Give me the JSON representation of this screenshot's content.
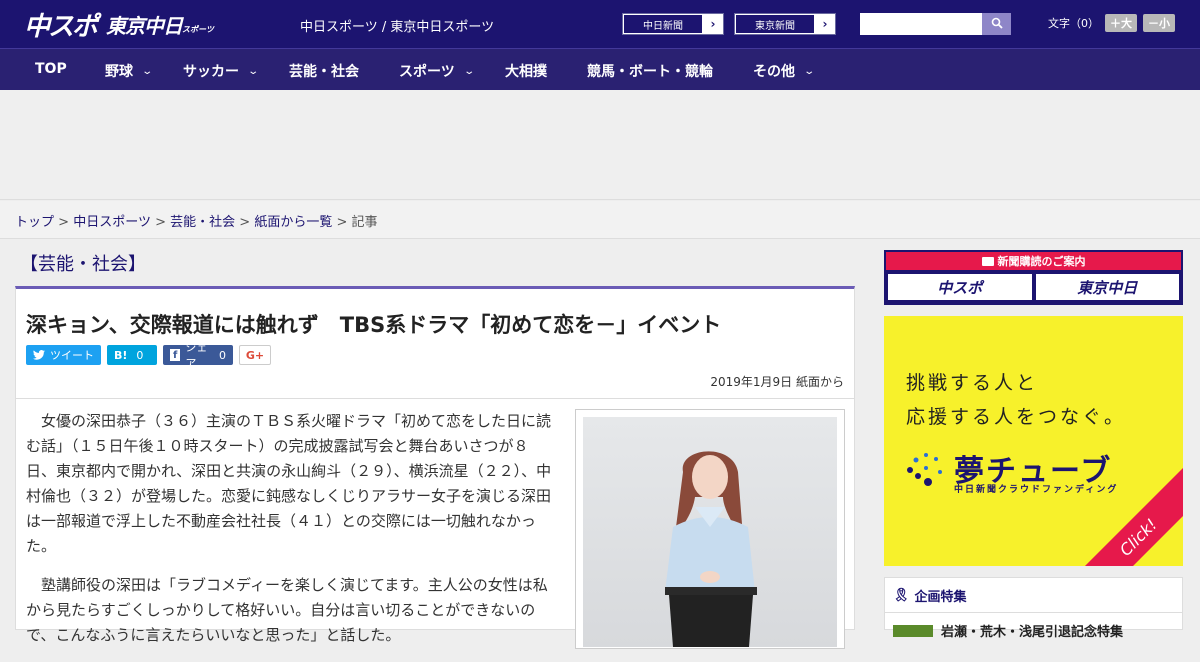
{
  "header": {
    "logo_main": "中スポ",
    "logo_sub": "東京中日",
    "logo_sub_tag": "スポーツ",
    "site_name": "中日スポーツ / 東京中日スポーツ",
    "btn_chunichi": "中日新聞",
    "btn_tokyo": "東京新聞",
    "search_placeholder": "",
    "font_label": "文字（0）",
    "font_plus": "＋大",
    "font_minus": "－小"
  },
  "nav": {
    "items": [
      {
        "label": "TOP",
        "dropdown": false
      },
      {
        "label": "野球",
        "dropdown": true
      },
      {
        "label": "サッカー",
        "dropdown": true
      },
      {
        "label": "芸能・社会",
        "dropdown": false
      },
      {
        "label": "スポーツ",
        "dropdown": true
      },
      {
        "label": "大相撲",
        "dropdown": false
      },
      {
        "label": "競馬・ボート・競輪",
        "dropdown": false
      },
      {
        "label": "その他",
        "dropdown": true
      }
    ]
  },
  "breadcrumb": {
    "items": [
      "トップ",
      "中日スポーツ",
      "芸能・社会",
      "紙面から一覧"
    ],
    "current": "記事",
    "separator": ">"
  },
  "article": {
    "category": "【芸能・社会】",
    "headline": "深キョン、交際報道には触れず　TBS系ドラマ「初めて恋を－」イベント",
    "social": {
      "twitter": "ツイート",
      "hatena_icon": "B!",
      "hatena_count": "0",
      "facebook": "シェア",
      "facebook_count": "0",
      "gplus": "G+"
    },
    "date": "2019年1月9日 紙面から",
    "paragraphs": [
      "女優の深田恭子（３６）主演のＴＢＳ系火曜ドラマ「初めて恋をした日に読む話」（１５日午後１０時スタート）の完成披露試写会と舞台あいさつが８日、東京都内で開かれ、深田と共演の永山絢斗（２９）、横浜流星（２２）、中村倫也（３２）が登場した。恋愛に鈍感なしくじりアラサー女子を演じる深田は一部報道で浮上した不動産会社社長（４１）との交際には一切触れなかった。",
      "塾講師役の深田は「ラブコメディーを楽しく演じてます。主人公の女性は私から見たらすごくしっかりして格好いい。自分は言い切ることができないので、こんなふうに言えたらいいなと思った」と話した。"
    ]
  },
  "sidebar": {
    "subscribe_head": "新聞購読のご案内",
    "subscribe_chuspo": "中スポ",
    "subscribe_tokyo": "東京中日",
    "yume_line1": "挑戦する人と",
    "yume_line2": "応援する人をつなぐ。",
    "yume_brand": "夢チューブ",
    "yume_sub": "中日新聞クラウドファンディング",
    "yume_click": "Click!",
    "kikaku_title": "企画特集",
    "kikaku_item": "岩瀬・荒木・浅尾引退記念特集"
  },
  "colors": {
    "brand": "#1c1470",
    "accent": "#e6194b",
    "yume_bg": "#f7f12b"
  }
}
